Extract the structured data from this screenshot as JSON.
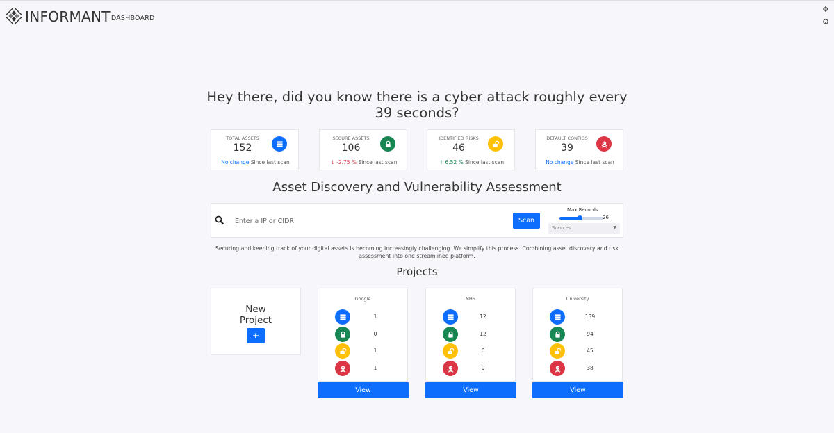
{
  "brand": {
    "name": "INFORMANT",
    "sub": "DASHBOARD"
  },
  "headline": "Hey there, did you know there is a cyber attack roughly every 39 seconds?",
  "stats": [
    {
      "label": "TOTAL ASSETS",
      "value": "152",
      "icon": "server-icon",
      "color": "#0d6efd",
      "change": "No change",
      "change_color": "#0d6efd",
      "arrow": "",
      "suffix": "Since last scan"
    },
    {
      "label": "SECURE ASSETS",
      "value": "106",
      "icon": "lock-icon",
      "color": "#198754",
      "change": "-2.75 %",
      "change_color": "#dc3545",
      "arrow": "down-arrow-icon",
      "suffix": "Since last scan"
    },
    {
      "label": "IDENTIFIED RISKS",
      "value": "46",
      "icon": "unlock-icon",
      "color": "#ffc107",
      "change": "6.52 %",
      "change_color": "#198754",
      "arrow": "up-arrow-icon",
      "suffix": "Since last scan"
    },
    {
      "label": "DEFAULT CONFIGS",
      "value": "39",
      "icon": "skull-icon",
      "color": "#dc3545",
      "change": "No change",
      "change_color": "#0d6efd",
      "arrow": "",
      "suffix": "Since last scan"
    }
  ],
  "discovery": {
    "title": "Asset Discovery and Vulnerability Assessment",
    "placeholder": "Enter a IP or CIDR",
    "scan_label": "Scan",
    "max_records_label": "Max Records",
    "max_records_value": "26",
    "max_records_fraction": 0.46,
    "sources_placeholder": "Sources"
  },
  "description": "Securing and keeping track of your digital assets is becoming increasingly challenging. We simplify this process. Combining asset discovery and risk assessment into one streamlined platform.",
  "projects_title": "Projects",
  "new_project": {
    "label_line1": "New",
    "label_line2": "Project",
    "button": "+"
  },
  "projects": [
    {
      "name": "Google",
      "counts": [
        "1",
        "0",
        "1",
        "1"
      ],
      "view": "View"
    },
    {
      "name": "NHS",
      "counts": [
        "12",
        "12",
        "0",
        "0"
      ],
      "view": "View"
    },
    {
      "name": "University",
      "counts": [
        "139",
        "94",
        "45",
        "38"
      ],
      "view": "View"
    }
  ],
  "colors": {
    "blue": "#0d6efd",
    "green": "#198754",
    "yellow": "#ffc107",
    "red": "#dc3545",
    "background": "#f7f7fb"
  }
}
